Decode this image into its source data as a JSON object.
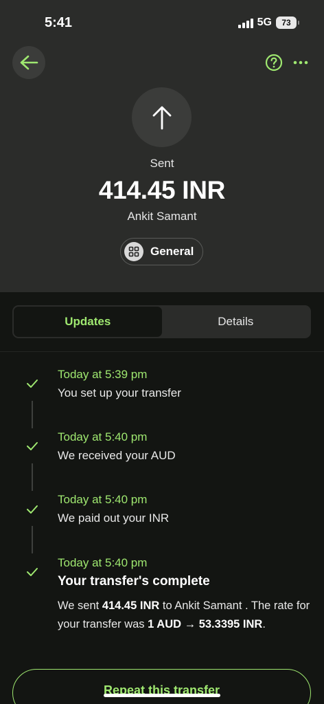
{
  "status_bar": {
    "time": "5:41",
    "network": "5G",
    "battery": "73"
  },
  "header": {
    "back_icon": "arrow-left-icon",
    "help_icon": "question-circle-icon",
    "more_icon": "ellipsis-icon",
    "transfer_icon": "arrow-up-icon",
    "status": "Sent",
    "amount": "414.45 INR",
    "recipient": "Ankit Samant",
    "category": {
      "icon": "grid-icon",
      "label": "General"
    }
  },
  "tabs": [
    {
      "label": "Updates",
      "active": true
    },
    {
      "label": "Details",
      "active": false
    }
  ],
  "updates": [
    {
      "time": "Today at 5:39 pm",
      "text": "You set up your transfer"
    },
    {
      "time": "Today at 5:40 pm",
      "text": "We received your AUD"
    },
    {
      "time": "Today at 5:40 pm",
      "text": "We paid out your INR"
    }
  ],
  "final_update": {
    "time": "Today at 5:40 pm",
    "title": "Your transfer's complete",
    "desc_1": "We sent ",
    "desc_amount": "414.45 INR",
    "desc_2": " to Ankit Samant . The rate for your transfer was ",
    "desc_rate": "1 AUD → 53.3395 INR",
    "desc_3": "."
  },
  "actions": {
    "repeat_label": "Repeat this transfer"
  },
  "colors": {
    "accent": "#9fe870",
    "background": "#131512",
    "surface": "#2b2c2a"
  }
}
